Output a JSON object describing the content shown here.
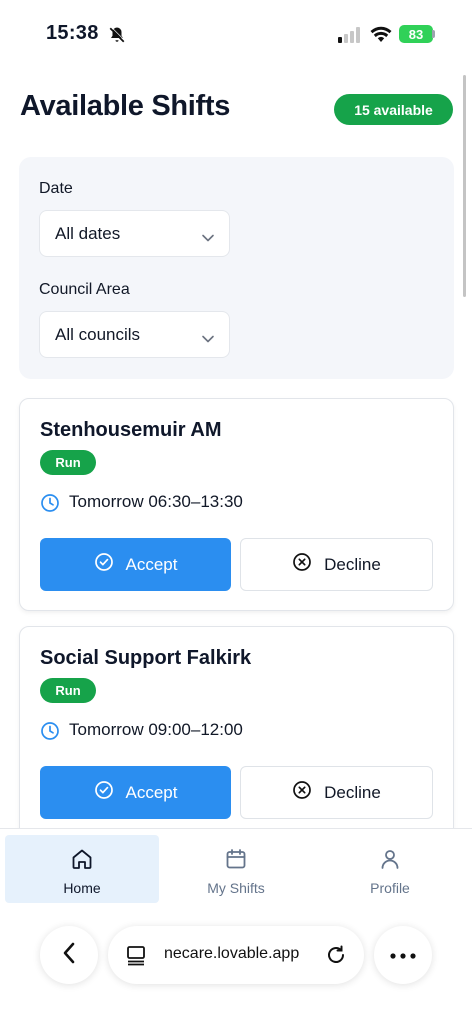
{
  "status_bar": {
    "time": "15:38",
    "battery": "83"
  },
  "header": {
    "title": "Available Shifts",
    "badge": "15 available"
  },
  "filters": {
    "date_label": "Date",
    "date_value": "All dates",
    "council_label": "Council Area",
    "council_value": "All councils"
  },
  "shifts": [
    {
      "title": "Stenhousemuir AM",
      "type": "Run",
      "time": "Tomorrow 06:30–13:30",
      "accept": "Accept",
      "decline": "Decline"
    },
    {
      "title": "Social Support Falkirk",
      "type": "Run",
      "time": "Tomorrow 09:00–12:00",
      "accept": "Accept",
      "decline": "Decline"
    }
  ],
  "tabs": [
    {
      "label": "Home",
      "icon": "home-icon",
      "active": true
    },
    {
      "label": "My Shifts",
      "icon": "calendar-icon",
      "active": false
    },
    {
      "label": "Profile",
      "icon": "user-icon",
      "active": false
    }
  ],
  "browser": {
    "url": "necare.lovable.app"
  },
  "colors": {
    "accent": "#2b8ef0",
    "success": "#16a34a",
    "active_tab": "#e6f1fc"
  }
}
